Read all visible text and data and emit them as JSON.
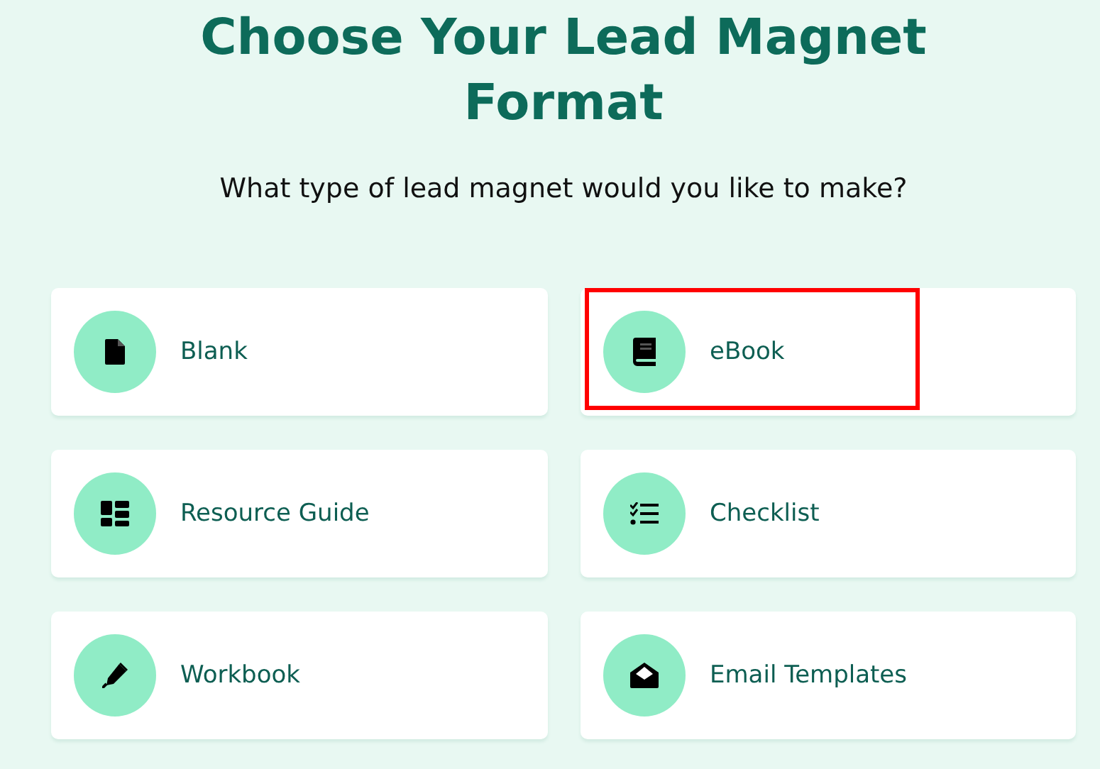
{
  "title": "Choose Your Lead Magnet Format",
  "subtitle": "What type of lead magnet would you like to make?",
  "formats": [
    {
      "label": "Blank",
      "kind": "file",
      "highlighted": false
    },
    {
      "label": "eBook",
      "kind": "book",
      "highlighted": true
    },
    {
      "label": "Resource Guide",
      "kind": "grid",
      "highlighted": false
    },
    {
      "label": "Checklist",
      "kind": "checklist",
      "highlighted": false
    },
    {
      "label": "Workbook",
      "kind": "pen",
      "highlighted": false
    },
    {
      "label": "Email Templates",
      "kind": "envelope",
      "highlighted": false
    }
  ]
}
